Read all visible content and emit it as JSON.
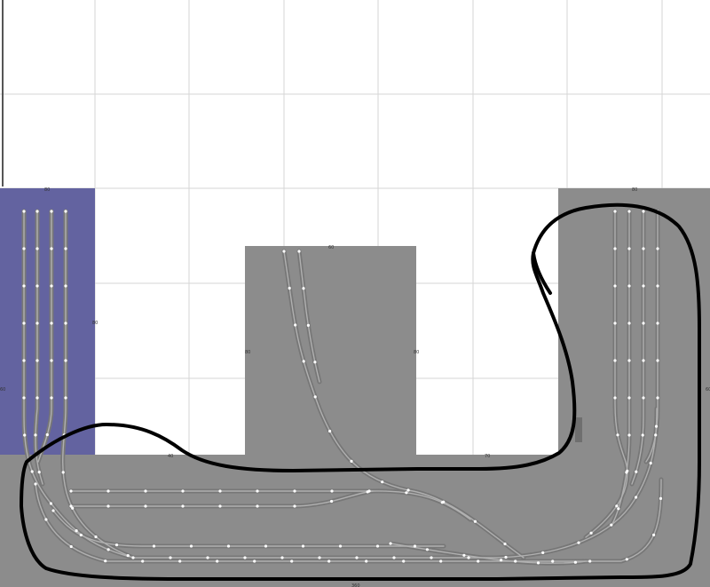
{
  "colors": {
    "background": "#ffffff",
    "grid": "#d6d6d6",
    "baseboard": "#8c8c8c",
    "staging_board": "#6363a0",
    "track": "#777777",
    "track_joint": "#ffffff",
    "sketch": "#000000"
  },
  "dimension_labels": {
    "staging_top": "80",
    "right_top": "80",
    "center_top": "60",
    "staging_side": "80",
    "center_left": "80",
    "center_right": "80",
    "left_edge": "60",
    "right_edge": "60",
    "bottom_left": "40",
    "bottom_right": "70",
    "bottom_edge": "360"
  },
  "annotation": {
    "type": "freehand-sketch",
    "color": "#000000"
  }
}
